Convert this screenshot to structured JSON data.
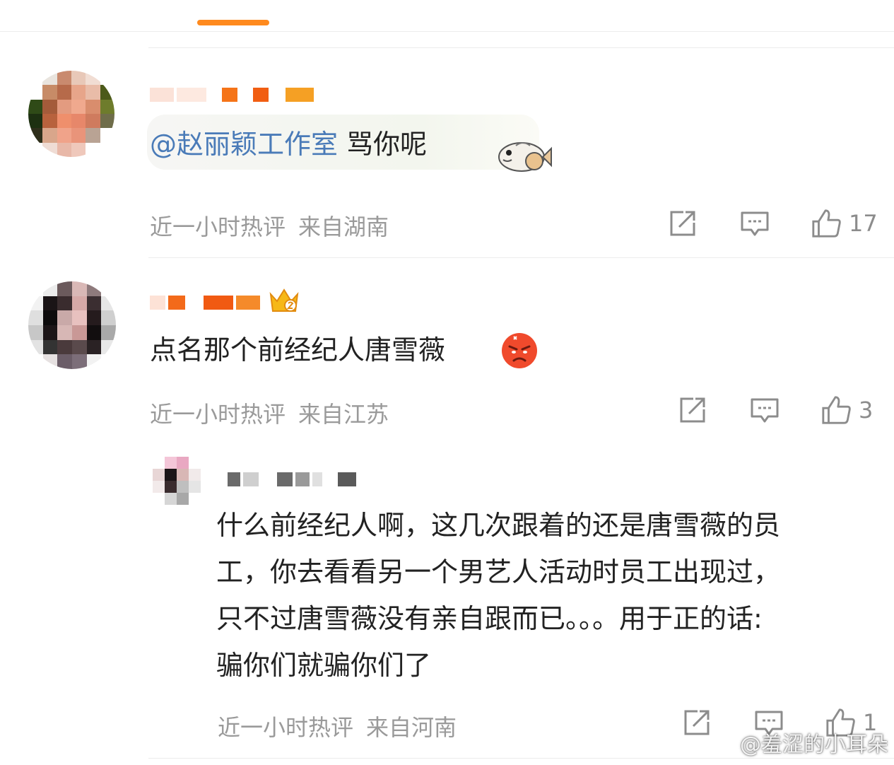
{
  "comments": [
    {
      "mention": "@赵丽颖工作室",
      "text": " 骂你呢",
      "sticker": "fish-sticker-icon",
      "time": "近一小时热评",
      "location": "来自湖南",
      "likes": "17"
    },
    {
      "text": "点名那个前经纪人唐雪薇",
      "emoji": "angry-face-icon",
      "time": "近一小时热评",
      "location": "来自江苏",
      "likes": "3"
    },
    {
      "text_lines": [
        "什么前经纪人啊，这几次跟着的还是唐雪薇的员",
        "工，你去看看另一个男艺人活动时员工出现过，",
        "只不过唐雪薇没有亲自跟而已。。。用于正的话:",
        "骗你们就骗你们了"
      ],
      "time": "近一小时热评",
      "location": "来自河南",
      "likes": "1"
    }
  ],
  "colors": {
    "accent": "#ff8a1e",
    "mention": "#4a7bb8",
    "meta": "#9a9a9a",
    "icon": "#8c8c8c"
  },
  "watermark": "@羞涩的小耳朵"
}
